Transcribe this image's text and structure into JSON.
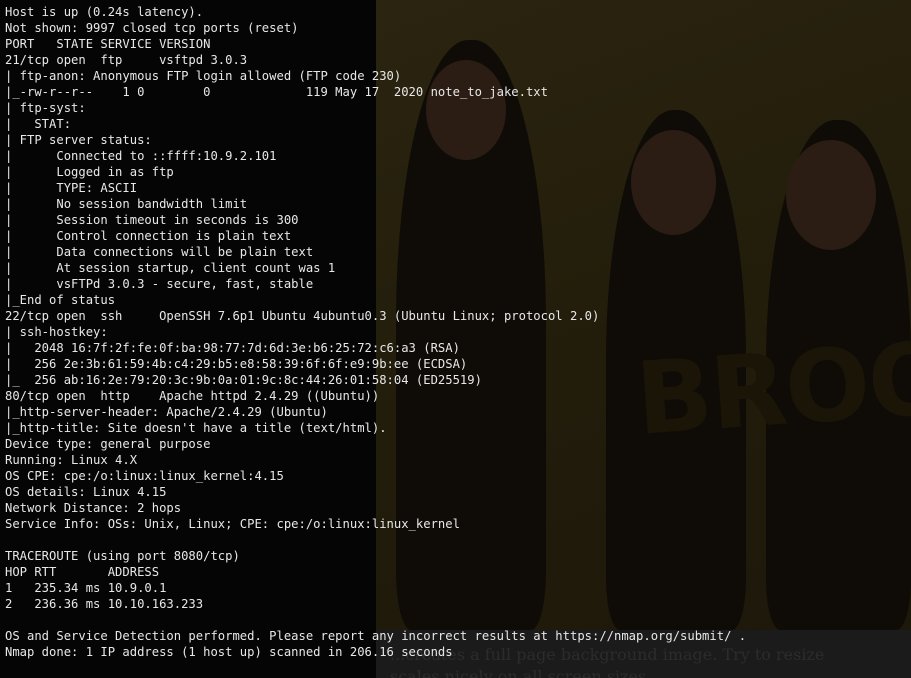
{
  "terminal": {
    "lines": [
      "Host is up (0.24s latency).",
      "Not shown: 9997 closed tcp ports (reset)",
      "PORT   STATE SERVICE VERSION",
      "21/tcp open  ftp     vsftpd 3.0.3",
      "| ftp-anon: Anonymous FTP login allowed (FTP code 230)",
      "|_-rw-r--r--    1 0        0             119 May 17  2020 note_to_jake.txt",
      "| ftp-syst:",
      "|   STAT:",
      "| FTP server status:",
      "|      Connected to ::ffff:10.9.2.101",
      "|      Logged in as ftp",
      "|      TYPE: ASCII",
      "|      No session bandwidth limit",
      "|      Session timeout in seconds is 300",
      "|      Control connection is plain text",
      "|      Data connections will be plain text",
      "|      At session startup, client count was 1",
      "|      vsFTPd 3.0.3 - secure, fast, stable",
      "|_End of status",
      "22/tcp open  ssh     OpenSSH 7.6p1 Ubuntu 4ubuntu0.3 (Ubuntu Linux; protocol 2.0)",
      "| ssh-hostkey:",
      "|   2048 16:7f:2f:fe:0f:ba:98:77:7d:6d:3e:b6:25:72:c6:a3 (RSA)",
      "|   256 2e:3b:61:59:4b:c4:29:b5:e8:58:39:6f:6f:e9:9b:ee (ECDSA)",
      "|_  256 ab:16:2e:79:20:3c:9b:0a:01:9c:8c:44:26:01:58:04 (ED25519)",
      "80/tcp open  http    Apache httpd 2.4.29 ((Ubuntu))",
      "|_http-server-header: Apache/2.4.29 (Ubuntu)",
      "|_http-title: Site doesn't have a title (text/html).",
      "Device type: general purpose",
      "Running: Linux 4.X",
      "OS CPE: cpe:/o:linux:linux_kernel:4.15",
      "OS details: Linux 4.15",
      "Network Distance: 2 hops",
      "Service Info: OSs: Unix, Linux; CPE: cpe:/o:linux:linux_kernel",
      "",
      "TRACEROUTE (using port 8080/tcp)",
      "HOP RTT       ADDRESS",
      "1   235.34 ms 10.9.0.1",
      "2   236.36 ms 10.10.163.233",
      "",
      "OS and Service Detection performed. Please report any incorrect results at https://nmap.org/submit/ .",
      "Nmap done: 1 IP address (1 host up) scanned in 206.16 seconds"
    ]
  },
  "background_page": {
    "logo_text": "BROO",
    "caption": "...creates a full page background image. Try to resize",
    "caption_line2": "scales nicely on all screen sizes.",
    "colors": {
      "banner": "#2a2410",
      "caption_bg": "#1b1b1b"
    }
  }
}
